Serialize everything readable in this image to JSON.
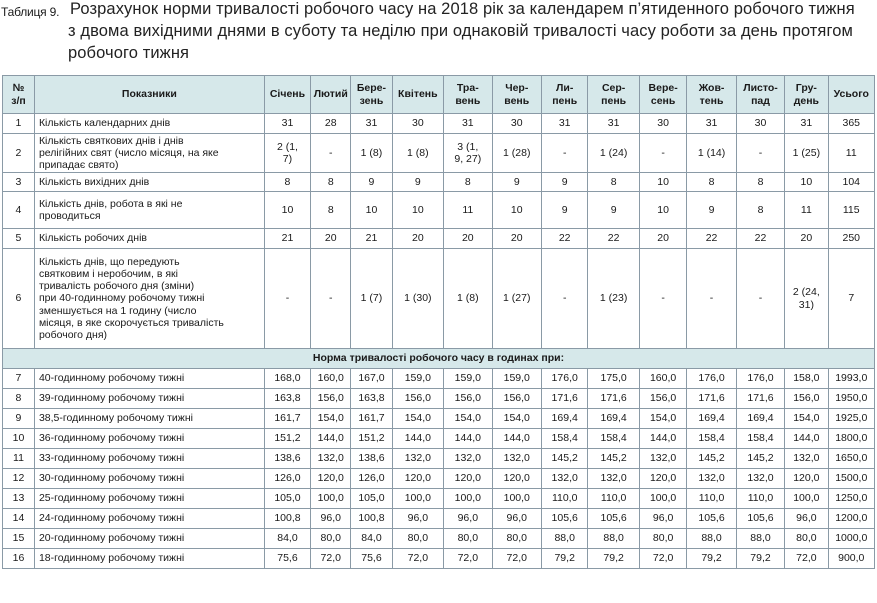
{
  "caption": {
    "label": "Таблиця 9.",
    "line1": "Розрахунок норми тривалості робочого часу на 2018 рік за календарем п’ятиденного робочого тижня",
    "line2": "з двома вихідними днями в суботу та неділю при однаковій тривалості часу роботи за день протягом",
    "line3": "робочого тижня"
  },
  "headers": [
    [
      "№",
      "з/п"
    ],
    [
      "Показники"
    ],
    [
      "Січень"
    ],
    [
      "Лютий"
    ],
    [
      "Бере-",
      "зень"
    ],
    [
      "Квітень"
    ],
    [
      "Тра-",
      "вень"
    ],
    [
      "Чер-",
      "вень"
    ],
    [
      "Ли-",
      "пень"
    ],
    [
      "Сер-",
      "пень"
    ],
    [
      "Вере-",
      "сень"
    ],
    [
      "Жов-",
      "тень"
    ],
    [
      "Листо-",
      "пад"
    ],
    [
      "Гру-",
      "день"
    ],
    [
      "Усього"
    ]
  ],
  "rows": [
    {
      "no": "1",
      "name": [
        "Кількість календарних днів"
      ],
      "values": [
        [
          "31"
        ],
        [
          "28"
        ],
        [
          "31"
        ],
        [
          "30"
        ],
        [
          "31"
        ],
        [
          "30"
        ],
        [
          "31"
        ],
        [
          "31"
        ],
        [
          "30"
        ],
        [
          "31"
        ],
        [
          "30"
        ],
        [
          "31"
        ],
        [
          "365"
        ]
      ]
    },
    {
      "no": "2",
      "name": [
        "Кількість святкових днів і днів",
        "релігійних свят (число місяця, на яке",
        "припадає свято)"
      ],
      "values": [
        [
          "2 (1,",
          "7)"
        ],
        [
          "-"
        ],
        [
          "1 (8)"
        ],
        [
          "1 (8)"
        ],
        [
          "3 (1,",
          "9, 27)"
        ],
        [
          "1 (28)"
        ],
        [
          "-"
        ],
        [
          "1 (24)"
        ],
        [
          "-"
        ],
        [
          "1 (14)"
        ],
        [
          "-"
        ],
        [
          "1 (25)"
        ],
        [
          "11"
        ]
      ]
    },
    {
      "no": "3",
      "name": [
        "Кількість вихідних днів"
      ],
      "values": [
        [
          "8"
        ],
        [
          "8"
        ],
        [
          "9"
        ],
        [
          "9"
        ],
        [
          "8"
        ],
        [
          "9"
        ],
        [
          "9"
        ],
        [
          "8"
        ],
        [
          "10"
        ],
        [
          "8"
        ],
        [
          "8"
        ],
        [
          "10"
        ],
        [
          "104"
        ]
      ]
    },
    {
      "no": "4",
      "name": [
        "Кількість днів, робота в які не",
        "проводиться"
      ],
      "values": [
        [
          "10"
        ],
        [
          "8"
        ],
        [
          "10"
        ],
        [
          "10"
        ],
        [
          "11"
        ],
        [
          "10"
        ],
        [
          "9"
        ],
        [
          "9"
        ],
        [
          "10"
        ],
        [
          "9"
        ],
        [
          "8"
        ],
        [
          "11"
        ],
        [
          "115"
        ]
      ]
    },
    {
      "no": "5",
      "name": [
        "Кількість робочих днів"
      ],
      "values": [
        [
          "21"
        ],
        [
          "20"
        ],
        [
          "21"
        ],
        [
          "20"
        ],
        [
          "20"
        ],
        [
          "20"
        ],
        [
          "22"
        ],
        [
          "22"
        ],
        [
          "20"
        ],
        [
          "22"
        ],
        [
          "22"
        ],
        [
          "20"
        ],
        [
          "250"
        ]
      ]
    },
    {
      "no": "6",
      "name": [
        "Кількість днів, що передують",
        "святковим і неробочим, в які",
        "тривалість робочого дня (зміни)",
        "при 40-годинному робочому тижні",
        "зменшується на 1 годину (число",
        "місяця, в яке скорочується тривалість",
        "робочого дня)"
      ],
      "values": [
        [
          "-"
        ],
        [
          "-"
        ],
        [
          "1 (7)"
        ],
        [
          "1 (30)"
        ],
        [
          "1 (8)"
        ],
        [
          "1 (27)"
        ],
        [
          "-"
        ],
        [
          "1 (23)"
        ],
        [
          "-"
        ],
        [
          "-"
        ],
        [
          "-"
        ],
        [
          "2 (24,",
          "31)"
        ],
        [
          "7"
        ]
      ]
    }
  ],
  "section_title": "Норма тривалості робочого часу в годинах при:",
  "norm_rows": [
    {
      "no": "7",
      "name": "40-годинному робочому тижні",
      "values": [
        "168,0",
        "160,0",
        "167,0",
        "159,0",
        "159,0",
        "159,0",
        "176,0",
        "175,0",
        "160,0",
        "176,0",
        "176,0",
        "158,0",
        "1993,0"
      ]
    },
    {
      "no": "8",
      "name": "39-годинному робочому тижні",
      "values": [
        "163,8",
        "156,0",
        "163,8",
        "156,0",
        "156,0",
        "156,0",
        "171,6",
        "171,6",
        "156,0",
        "171,6",
        "171,6",
        "156,0",
        "1950,0"
      ]
    },
    {
      "no": "9",
      "name": "38,5-годинному робочому тижні",
      "values": [
        "161,7",
        "154,0",
        "161,7",
        "154,0",
        "154,0",
        "154,0",
        "169,4",
        "169,4",
        "154,0",
        "169,4",
        "169,4",
        "154,0",
        "1925,0"
      ]
    },
    {
      "no": "10",
      "name": "36-годинному робочому тижні",
      "values": [
        "151,2",
        "144,0",
        "151,2",
        "144,0",
        "144,0",
        "144,0",
        "158,4",
        "158,4",
        "144,0",
        "158,4",
        "158,4",
        "144,0",
        "1800,0"
      ]
    },
    {
      "no": "11",
      "name": "33-годинному робочому тижні",
      "values": [
        "138,6",
        "132,0",
        "138,6",
        "132,0",
        "132,0",
        "132,0",
        "145,2",
        "145,2",
        "132,0",
        "145,2",
        "145,2",
        "132,0",
        "1650,0"
      ]
    },
    {
      "no": "12",
      "name": "30-годинному робочому тижні",
      "values": [
        "126,0",
        "120,0",
        "126,0",
        "120,0",
        "120,0",
        "120,0",
        "132,0",
        "132,0",
        "120,0",
        "132,0",
        "132,0",
        "120,0",
        "1500,0"
      ]
    },
    {
      "no": "13",
      "name": "25-годинному робочому тижні",
      "values": [
        "105,0",
        "100,0",
        "105,0",
        "100,0",
        "100,0",
        "100,0",
        "110,0",
        "110,0",
        "100,0",
        "110,0",
        "110,0",
        "100,0",
        "1250,0"
      ]
    },
    {
      "no": "14",
      "name": "24-годинному робочому тижні",
      "values": [
        "100,8",
        "96,0",
        "100,8",
        "96,0",
        "96,0",
        "96,0",
        "105,6",
        "105,6",
        "96,0",
        "105,6",
        "105,6",
        "96,0",
        "1200,0"
      ]
    },
    {
      "no": "15",
      "name": "20-годинному робочому тижні",
      "values": [
        "84,0",
        "80,0",
        "84,0",
        "80,0",
        "80,0",
        "80,0",
        "88,0",
        "88,0",
        "80,0",
        "88,0",
        "88,0",
        "80,0",
        "1000,0"
      ]
    },
    {
      "no": "16",
      "name": "18-годинному робочому тижні",
      "values": [
        "75,6",
        "72,0",
        "75,6",
        "72,0",
        "72,0",
        "72,0",
        "79,2",
        "79,2",
        "72,0",
        "79,2",
        "79,2",
        "72,0",
        "900,0"
      ]
    }
  ]
}
